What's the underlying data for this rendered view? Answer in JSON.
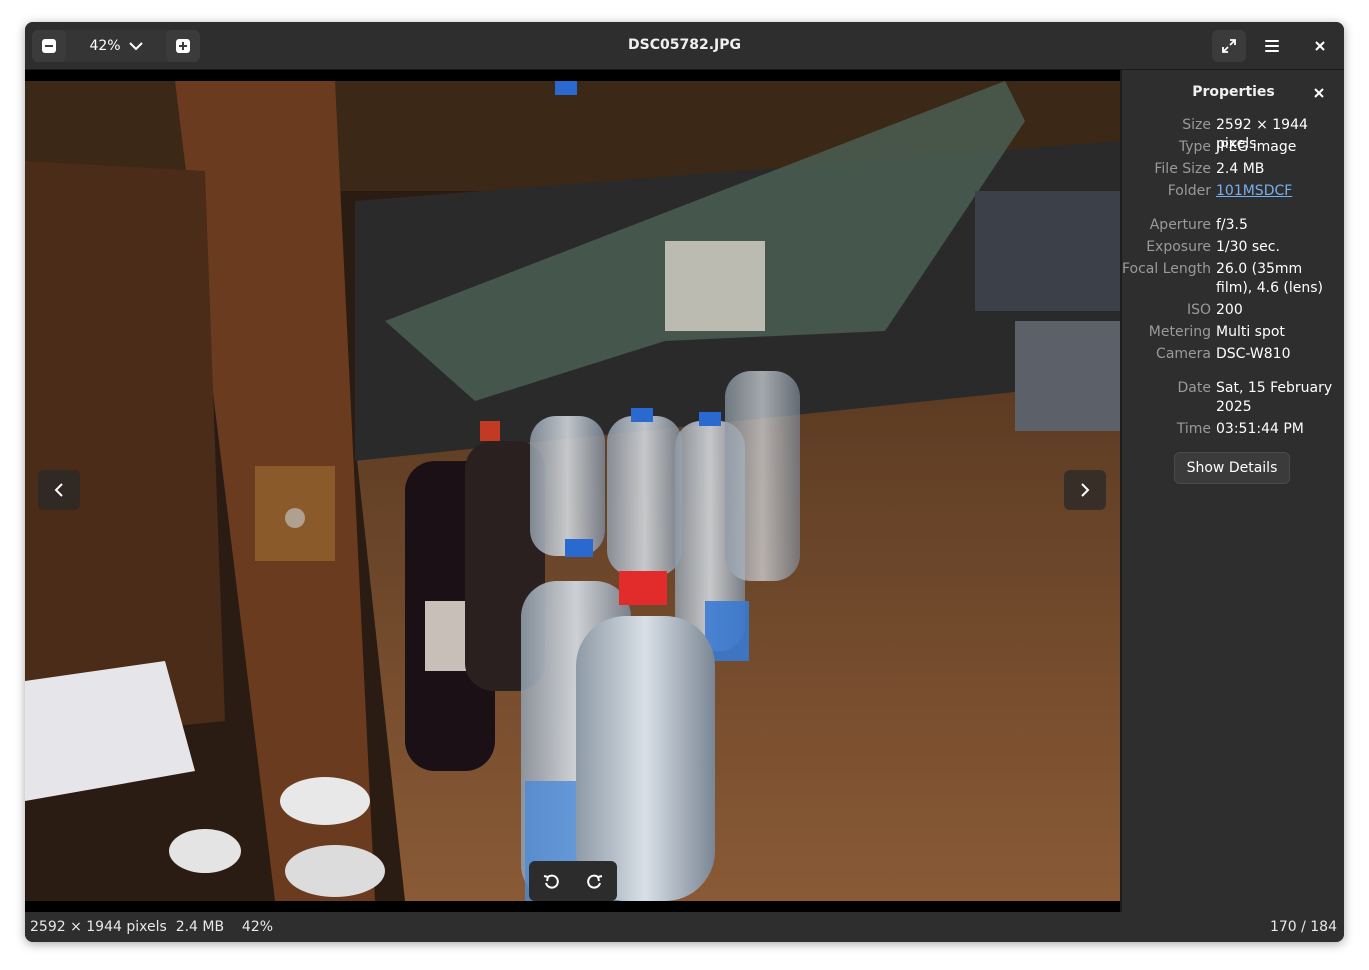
{
  "window": {
    "title": "DSC05782.JPG"
  },
  "toolbar": {
    "zoom_level": "42%"
  },
  "properties": {
    "title": "Properties",
    "rows": [
      {
        "label": "Size",
        "value": "2592 × 1944 pixels"
      },
      {
        "label": "Type",
        "value": "JPEG image"
      },
      {
        "label": "File Size",
        "value": "2.4 MB"
      },
      {
        "label": "Folder",
        "value": "101MSDCF"
      },
      {
        "label": "Aperture",
        "value": "f/3.5"
      },
      {
        "label": "Exposure",
        "value": "1/30 sec."
      },
      {
        "label": "Focal Length",
        "value": "26.0 (35mm film), 4.6 (lens)"
      },
      {
        "label": "ISO",
        "value": "200"
      },
      {
        "label": "Metering",
        "value": "Multi spot"
      },
      {
        "label": "Camera",
        "value": "DSC-W810"
      },
      {
        "label": "Date",
        "value": "Sat, 15 February 2025"
      },
      {
        "label": "Time",
        "value": "03:51:44 PM"
      }
    ],
    "show_details_label": "Show Details"
  },
  "statusbar": {
    "dimensions": "2592 × 1944 pixels",
    "file_size": "2.4 MB",
    "zoom": "42%",
    "position": "170 / 184"
  },
  "icons": {
    "zoom_out": "zoom-out-icon",
    "zoom_in": "zoom-in-icon",
    "dropdown": "chevron-down-icon",
    "fullscreen": "fullscreen-icon",
    "menu": "hamburger-menu-icon",
    "close": "close-icon",
    "prev": "chevron-left-icon",
    "next": "chevron-right-icon",
    "rotate_left": "rotate-left-icon",
    "rotate_right": "rotate-right-icon"
  },
  "colors": {
    "link": "#78aeed",
    "panel_bg": "#2e2e2e",
    "viewer_bg": "#000000"
  }
}
